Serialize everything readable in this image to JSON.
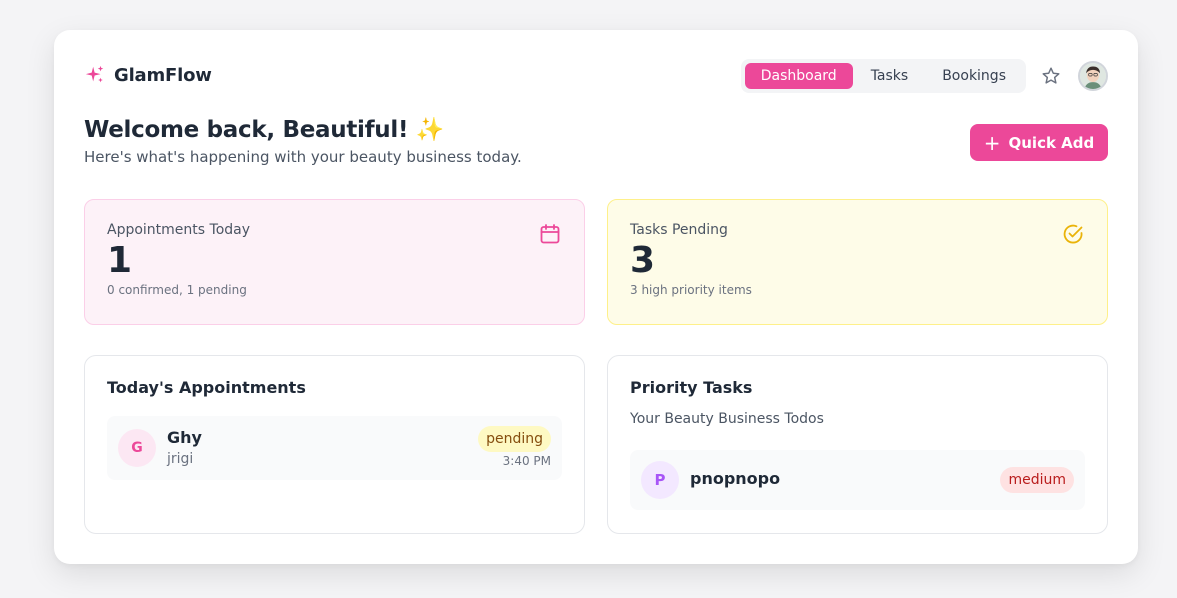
{
  "brand": {
    "name": "GlamFlow",
    "icon": "sparkles-icon",
    "color": "#ec4899"
  },
  "nav": {
    "tabs": [
      {
        "label": "Dashboard",
        "active": true
      },
      {
        "label": "Tasks",
        "active": false
      },
      {
        "label": "Bookings",
        "active": false
      }
    ],
    "favorite_icon": "star-icon",
    "avatar_icon": "user-avatar"
  },
  "welcome": {
    "title": "Welcome back, Beautiful! ✨",
    "subtitle": "Here's what's happening with your beauty business today."
  },
  "quick_add": {
    "label": "Quick Add",
    "icon": "plus-icon"
  },
  "stats": {
    "appointments": {
      "label": "Appointments Today",
      "value": "1",
      "desc": "0 confirmed, 1 pending",
      "icon": "calendar-icon",
      "color": "#ec4899"
    },
    "tasks": {
      "label": "Tasks Pending",
      "value": "3",
      "desc": "3 high priority items",
      "icon": "check-circle-icon",
      "color": "#eab308"
    }
  },
  "appointments_panel": {
    "title": "Today's Appointments",
    "items": [
      {
        "initial": "G",
        "name": "Ghy",
        "service": "jrigi",
        "status": "pending",
        "time": "3:40 PM"
      }
    ]
  },
  "tasks_panel": {
    "title": "Priority Tasks",
    "subtitle": "Your Beauty Business Todos",
    "items": [
      {
        "initial": "P",
        "title": "pnopnopo",
        "priority": "medium"
      }
    ]
  }
}
